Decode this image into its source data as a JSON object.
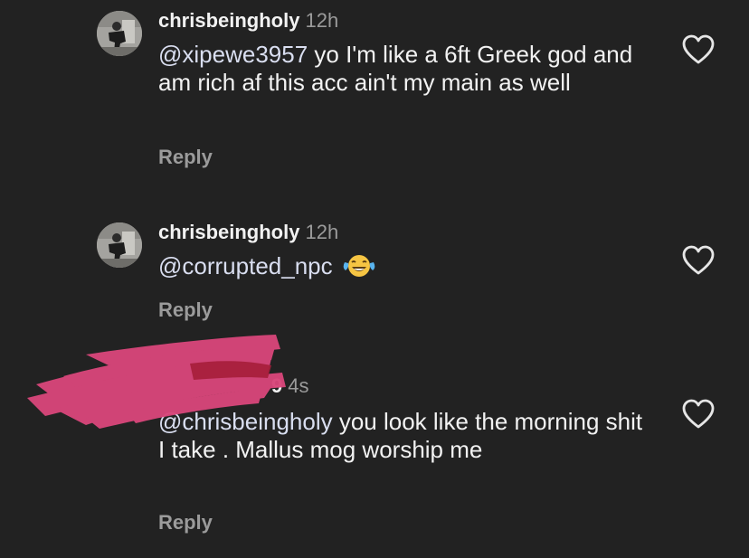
{
  "comments": [
    {
      "username": "chrisbeingholy",
      "time": "12h",
      "mention": "@xipewe3957",
      "text": " yo I'm like a 6ft Greek god and am rich af this acc ain't my main as well",
      "reply_label": "Reply"
    },
    {
      "username": "chrisbeingholy",
      "time": "12h",
      "mention": "@corrupted_npc",
      "text": " ",
      "emoji": "face-with-tears-of-joy",
      "reply_label": "Reply"
    },
    {
      "username": "9",
      "time": "4s",
      "mention": "@chrisbeingholy",
      "text": " you look like the morning shit I take . Mallus mog worship me",
      "reply_label": "Reply"
    }
  ],
  "icons": {
    "like": "heart-outline-icon"
  },
  "colors": {
    "background": "#222222",
    "text": "#f2f2f2",
    "muted": "#9b9b9b",
    "redaction": "#d8467a"
  }
}
